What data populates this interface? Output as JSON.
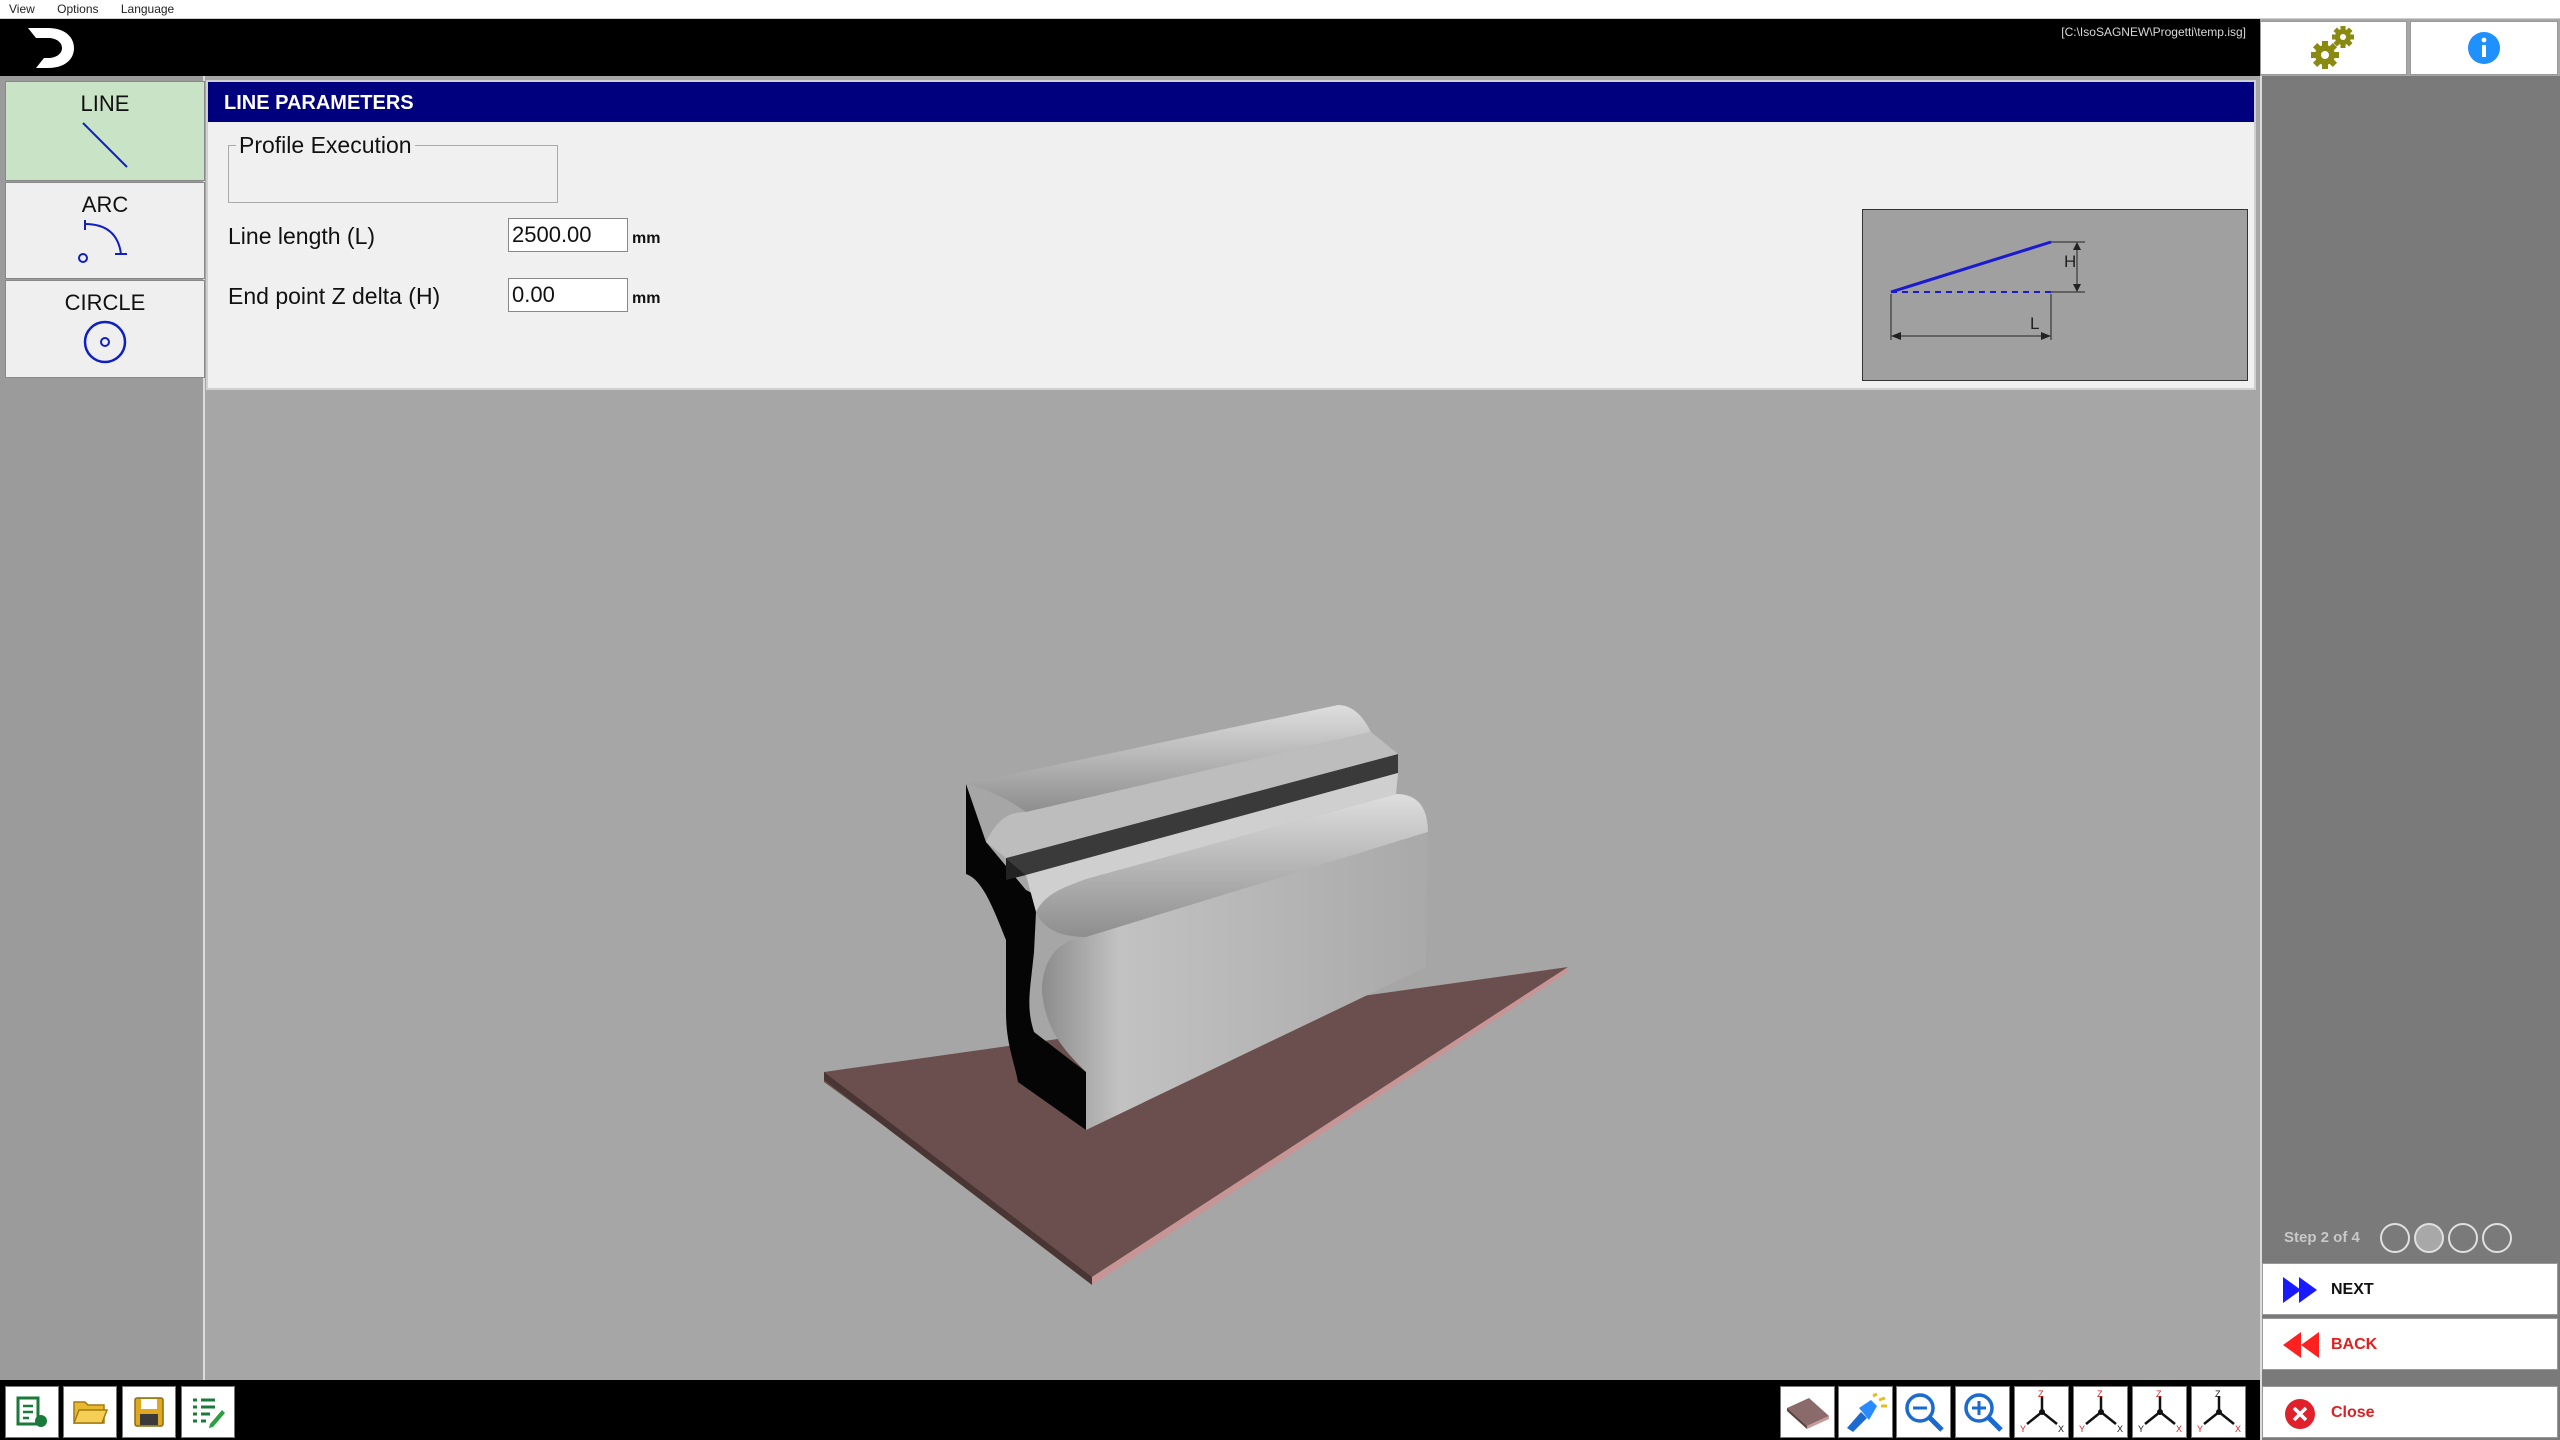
{
  "menu": [
    "View",
    "Options",
    "Language"
  ],
  "file_path": "[C:\\IsoSAGNEW\\Progetti\\temp.isg]",
  "shapes": [
    {
      "label": "LINE",
      "active": true
    },
    {
      "label": "ARC",
      "active": false
    },
    {
      "label": "CIRCLE",
      "active": false
    }
  ],
  "params": {
    "title": "LINE PARAMETERS",
    "profile_execution_label": "Profile Execution",
    "line_length_label": "Line length (L)",
    "line_length_value": "2500.00",
    "end_z_label": "End point Z delta (H)",
    "end_z_value": "0.00",
    "unit": "mm",
    "diagram_h": "H",
    "diagram_l": "L"
  },
  "step": {
    "text": "Step 2 of 4",
    "current": 2,
    "total": 4
  },
  "nav": {
    "next": "NEXT",
    "back": "BACK",
    "close": "Close"
  },
  "colors": {
    "header": "#00007f",
    "active_tab": "#c9e3c7",
    "next": "#1a1aff",
    "back": "#ff2020",
    "close": "#e0202a",
    "base": "#6b4f4f"
  },
  "icons": {
    "settings": "gears-icon",
    "info": "info-icon",
    "bottom_left": [
      "new-document-icon",
      "open-folder-icon",
      "save-icon",
      "edit-list-icon"
    ],
    "view_tools": [
      "stock-icon",
      "flashlight-icon",
      "zoom-out-icon",
      "zoom-in-icon",
      "view-top-icon",
      "view-front-icon",
      "view-side-icon",
      "view-iso-icon"
    ]
  }
}
